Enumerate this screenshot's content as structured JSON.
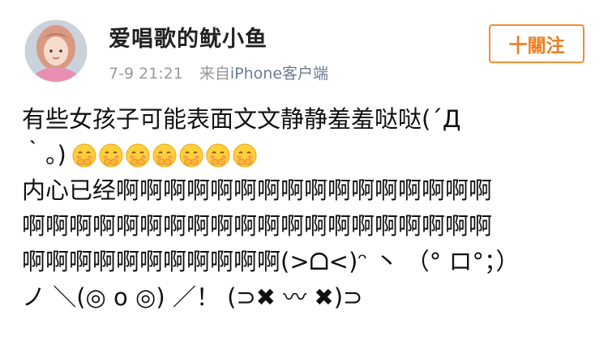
{
  "header": {
    "username": "爱唱歌的鱿小鱼",
    "time": "7-9 21:21",
    "source_prefix": "来自",
    "source_name": "iPhone客户端",
    "follow_label": "十關注"
  },
  "post": {
    "line1": "有些女孩子可能表面文文静静羞羞哒哒(´Д",
    "line2_text": "｀。)",
    "emoji_count": 7,
    "emoji_icon": "shy-covering-face-emoji",
    "line3": "内心已经啊啊啊啊啊啊啊啊啊啊啊啊啊啊啊啊",
    "line4": "啊啊啊啊啊啊啊啊啊啊啊啊啊啊啊啊啊啊啊啊",
    "line5": "啊啊啊啊啊啊啊啊啊啊啊(>ᗝ<)ᵔ 丶 （°  ロ°；）",
    "line6": "ノ ＼(◎ o ◎) ／！ (⊃✖ 〰 ✖)⊃"
  },
  "colors": {
    "accent": "#f07d1f",
    "meta_gray": "#9a9a9a",
    "link_blue": "#6a7c94"
  }
}
